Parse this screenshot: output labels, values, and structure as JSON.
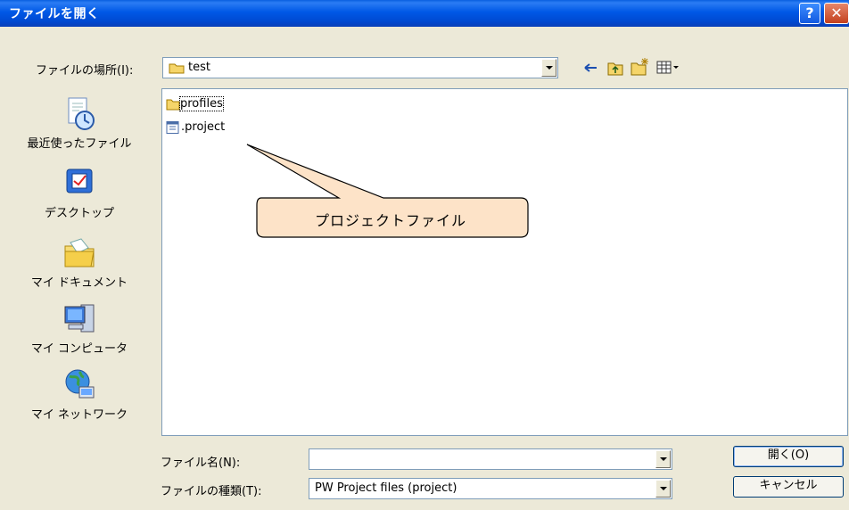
{
  "title": "ファイルを開く",
  "titlebar": {
    "help_label": "?",
    "close_label": "✕"
  },
  "look_in": {
    "label": "ファイルの場所(I):",
    "value": "test"
  },
  "toolbar": {
    "icons": [
      "back-icon",
      "up-folder-icon",
      "new-folder-icon",
      "view-menu-icon"
    ]
  },
  "places": [
    {
      "label": "最近使ったファイル",
      "icon": "recent-documents-icon"
    },
    {
      "label": "デスクトップ",
      "icon": "desktop-icon"
    },
    {
      "label": "マイ ドキュメント",
      "icon": "my-documents-icon"
    },
    {
      "label": "マイ コンピュータ",
      "icon": "my-computer-icon"
    },
    {
      "label": "マイ ネットワーク",
      "icon": "my-network-icon"
    }
  ],
  "files": [
    {
      "name": "profiles",
      "icon": "folder-icon"
    },
    {
      "name": ".project",
      "icon": "project-file-icon"
    }
  ],
  "callout": {
    "text": "プロジェクトファイル"
  },
  "filename": {
    "label": "ファイル名(N):",
    "value": ""
  },
  "filetype": {
    "label": "ファイルの種類(T):",
    "value": "PW Project files (project)"
  },
  "buttons": {
    "open": "開く(O)",
    "cancel": "キャンセル"
  },
  "colors": {
    "titlebar": "#0058e6",
    "dialog_bg": "#ece9d8",
    "callout_fill": "#fde3c8",
    "folder": "#f5d56a"
  }
}
